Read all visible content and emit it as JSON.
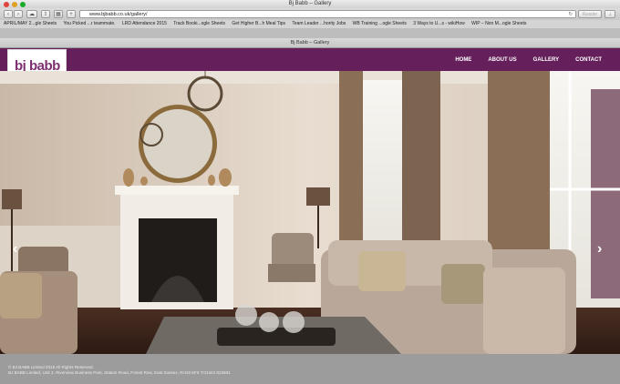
{
  "window": {
    "title": "Bj Babb – Gallery"
  },
  "toolbar": {
    "back_icon": "chevron-left-icon",
    "forward_icon": "chevron-right-icon",
    "url": "www.bjbabb.co.uk/gallery/",
    "reader_label": "Reader"
  },
  "bookmarks": [
    "APRIL/MAY 2...gle Sheets",
    "You Picked ...r teammate.",
    "LRD Attendance 2015",
    "Track Booki...ogle Sheets",
    "Get Higher B...h Meal Tips",
    "Team Leader ...hority Jobs",
    "WB Training ...ogle Sheets",
    "3 Ways to U...s - wikiHow",
    "WIP – Non M...ogle Sheets"
  ],
  "tab": {
    "title": "Bj Babb – Gallery"
  },
  "site": {
    "logo_text": "bj babb",
    "nav": [
      "HOME",
      "ABOUT US",
      "GALLERY",
      "CONTACT"
    ]
  },
  "footer": {
    "line1": "© BJ BABB Limited 2015 All Rights Reserved.",
    "line2": "BJ BABB Limited, Unit 2, Riverview Business Park, Station Road, Forest Row, East Sussex, RH18 5FS T:01342 823601"
  },
  "colors": {
    "nav_bg": "#651f5b",
    "footer_bg": "#9c9c9c"
  }
}
